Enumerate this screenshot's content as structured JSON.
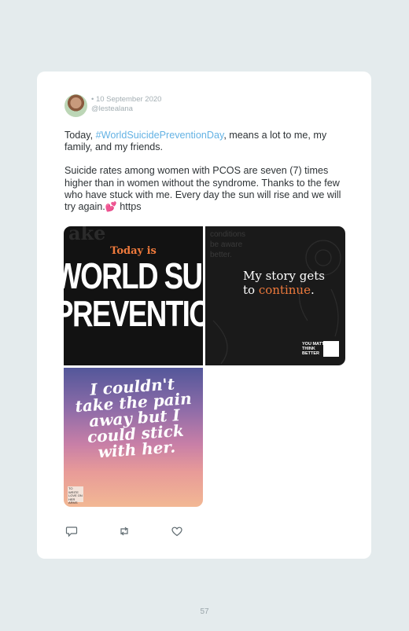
{
  "tweet": {
    "date": "• 10 September 2020",
    "handle": "@lestealana",
    "text_part1": "Today, ",
    "hashtag": "#WorldSuicidePreventionDay",
    "text_part2": ", means a lot to me, my family, and my friends.",
    "paragraph2": "Suicide rates among women with PCOS are seven (7) times higher than in women without the syndrome. Thanks to the few who have stuck with me. Every day the sun will rise and we will try again.",
    "emoji": "💕",
    "link": " https"
  },
  "images": {
    "image1": {
      "ghost": "ake",
      "kicker": "Today is",
      "line1": "WORLD SUICID",
      "line2": "PREVENTION DA"
    },
    "image2": {
      "faint": "conditions\nbe aware\nbetter.",
      "text_part1": "My story gets to ",
      "text_accent": "continue",
      "text_part2": ".",
      "logo": "YOU MATTER\nTHINK\nBETTER"
    },
    "image3": {
      "script": "I couldn't take the pain away but I could stick with her.",
      "logo": "TO WRITE LOVE ON HER ARMS"
    }
  },
  "actions": {
    "reply_icon": "reply-icon",
    "retweet_icon": "retweet-icon",
    "like_icon": "heart-icon"
  },
  "page_number": "57"
}
